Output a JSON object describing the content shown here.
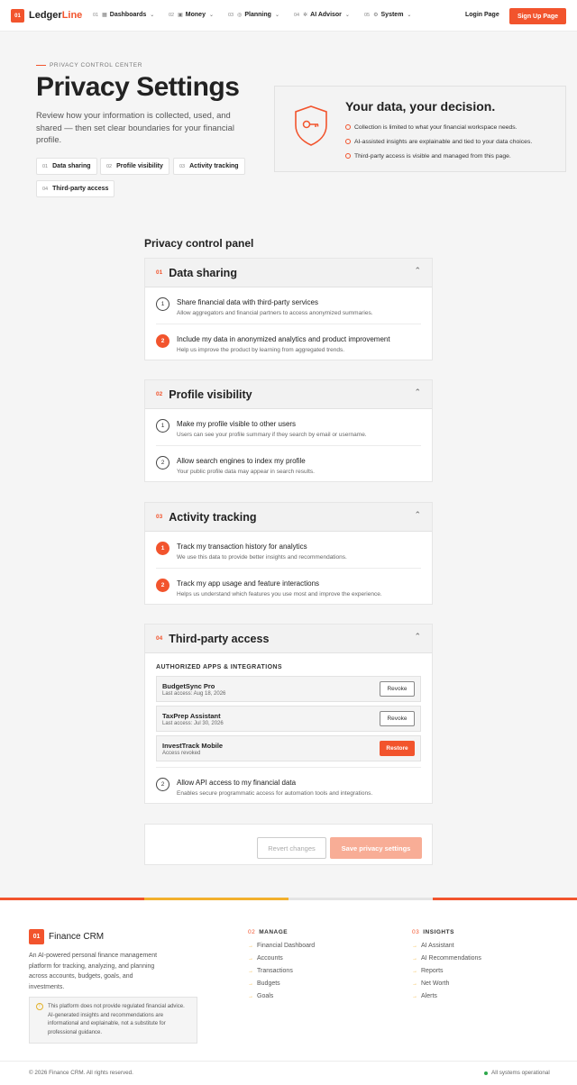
{
  "nav": {
    "logo_num": "01",
    "brand_a": "Ledger",
    "brand_b": "Line",
    "items": [
      {
        "num": "01",
        "icon": "grid-icon",
        "label": "Dashboards"
      },
      {
        "num": "02",
        "icon": "wallet-icon",
        "label": "Money"
      },
      {
        "num": "03",
        "icon": "target-icon",
        "label": "Planning"
      },
      {
        "num": "04",
        "icon": "sparkle-icon",
        "label": "AI Advisor"
      },
      {
        "num": "05",
        "icon": "gear-icon",
        "label": "System"
      }
    ],
    "login": "Login Page",
    "signup": "Sign Up Page"
  },
  "hero": {
    "eyebrow": "PRIVACY CONTROL CENTER",
    "title": "Privacy Settings",
    "description": "Review how your information is collected, used, and shared — then set clear boundaries for your financial profile.",
    "chips": [
      {
        "num": "01",
        "label": "Data sharing"
      },
      {
        "num": "02",
        "label": "Profile visibility"
      },
      {
        "num": "03",
        "label": "Activity tracking"
      },
      {
        "num": "04",
        "label": "Third-party access"
      }
    ],
    "card": {
      "icon": "shield-key-icon",
      "title": "Your data, your decision.",
      "points": [
        "Collection is limited to what your financial workspace needs.",
        "AI-assisted insights are explainable and tied to your data choices.",
        "Third-party access is visible and managed from this page."
      ]
    }
  },
  "panel": {
    "title": "Privacy control panel",
    "sections": [
      {
        "num": "01",
        "title": "Data sharing",
        "rows": [
          {
            "state": "1",
            "on": false,
            "title": "Share financial data with third-party services",
            "sub": "Allow aggregators and financial partners to access anonymized summaries."
          },
          {
            "state": "2",
            "on": true,
            "title": "Include my data in anonymized analytics and product improvement",
            "sub": "Help us improve the product by learning from aggregated trends."
          }
        ]
      },
      {
        "num": "02",
        "title": "Profile visibility",
        "rows": [
          {
            "state": "1",
            "on": false,
            "title": "Make my profile visible to other users",
            "sub": "Users can see your profile summary if they search by email or username."
          },
          {
            "state": "2",
            "on": false,
            "title": "Allow search engines to index my profile",
            "sub": "Your public profile data may appear in search results."
          }
        ]
      },
      {
        "num": "03",
        "title": "Activity tracking",
        "rows": [
          {
            "state": "1",
            "on": true,
            "title": "Track my transaction history for analytics",
            "sub": "We use this data to provide better insights and recommendations."
          },
          {
            "state": "2",
            "on": true,
            "title": "Track my app usage and feature interactions",
            "sub": "Helps us understand which features you use most and improve the experience."
          }
        ]
      },
      {
        "num": "04",
        "title": "Third-party access",
        "apps_label": "AUTHORIZED APPS & INTEGRATIONS",
        "apps": [
          {
            "name": "BudgetSync Pro",
            "sub": "Last access: Aug 18, 2026",
            "action": "Revoke"
          },
          {
            "name": "TaxPrep Assistant",
            "sub": "Last access: Jul 30, 2026",
            "action": "Revoke"
          },
          {
            "name": "InvestTrack Mobile",
            "sub": "Access revoked",
            "action": "Restore"
          }
        ],
        "rows": [
          {
            "state": "2",
            "on": false,
            "title": "Allow API access to my financial data",
            "sub": "Enables secure programmatic access for automation tools and integrations."
          }
        ]
      }
    ],
    "revert": "Revert changes",
    "save": "Save privacy settings"
  },
  "footer": {
    "logo_num": "01",
    "brand": "Finance CRM",
    "description": "An AI-powered personal finance management platform for tracking, analyzing, and planning across accounts, budgets, goals, and investments.",
    "notice": "This platform does not provide regulated financial advice. AI-generated insights and recommendations are informational and explainable, not a substitute for professional guidance.",
    "cols": [
      {
        "num": "02",
        "title": "MANAGE",
        "links": [
          "Financial Dashboard",
          "Accounts",
          "Transactions",
          "Budgets",
          "Goals"
        ]
      },
      {
        "num": "03",
        "title": "INSIGHTS",
        "links": [
          "AI Assistant",
          "AI Recommendations",
          "Reports",
          "Net Worth",
          "Alerts"
        ]
      }
    ],
    "copyright": "© 2026 Finance CRM. All rights reserved.",
    "status": "All systems operational"
  },
  "colors": {
    "accent": "#f2542d",
    "accent_light": "#f8ad96",
    "warning": "#e2b22b",
    "success": "#2da84b"
  }
}
